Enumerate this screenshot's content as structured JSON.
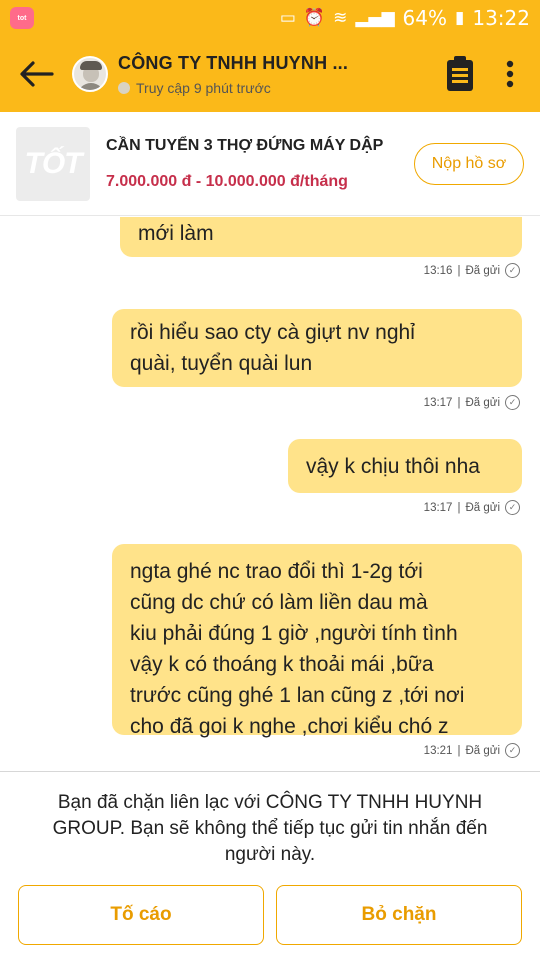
{
  "status_bar": {
    "app_icon_label": "tot",
    "battery": "64%",
    "time": "13:22"
  },
  "header": {
    "company_name": "CÔNG TY TNHH HUYNH ...",
    "presence": "Truy cập 9 phút trước",
    "icons": [
      "back-arrow-icon",
      "avatar",
      "clipboard-icon",
      "more-vertical-icon"
    ]
  },
  "job": {
    "logo_text": "TỐT",
    "title": "CẦN TUYỂN 3 THỢ ĐỨNG MÁY DẬP",
    "salary": "7.000.000 đ - 10.000.000 đ/tháng",
    "apply_label": "Nộp hồ sơ"
  },
  "messages": [
    {
      "lines": [
        "mới làm"
      ],
      "time": "13:16",
      "status": "Đã gửi"
    },
    {
      "lines": [
        "rồi hiểu sao cty cà giựt nv nghỉ",
        "quài, tuyển quài lun"
      ],
      "time": "13:17",
      "status": "Đã gửi"
    },
    {
      "lines": [
        "vậy k chịu thôi nha"
      ],
      "time": "13:17",
      "status": "Đã gửi"
    },
    {
      "lines": [
        "ngta ghé nc trao đổi thì 1-2g tới",
        "cũng dc chứ có làm liền  dau mà",
        "kiu phải đúng 1 giờ ,người tính tình",
        "vậy k có thoáng k thoải mái ,bữa",
        "trước cũng ghé 1 lan cũng z ,tới nơi",
        "cho đã goi k nghe ,chơi kiểu chó z"
      ],
      "time": "13:21",
      "status": "Đã gửi"
    }
  ],
  "blocked": {
    "line1": "Bạn đã chặn liên lạc với CÔNG TY TNHH HUYNH",
    "line2": "GROUP. Bạn sẽ không thể tiếp tục gửi tin nhắn đến",
    "line3": "người này.",
    "report_label": "Tố cáo",
    "unblock_label": "Bỏ chặn"
  },
  "colors": {
    "brand_yellow": "#fbb919",
    "bubble": "#ffe38a",
    "salary_red": "#c62f4b",
    "accent_orange": "#e99c00"
  }
}
